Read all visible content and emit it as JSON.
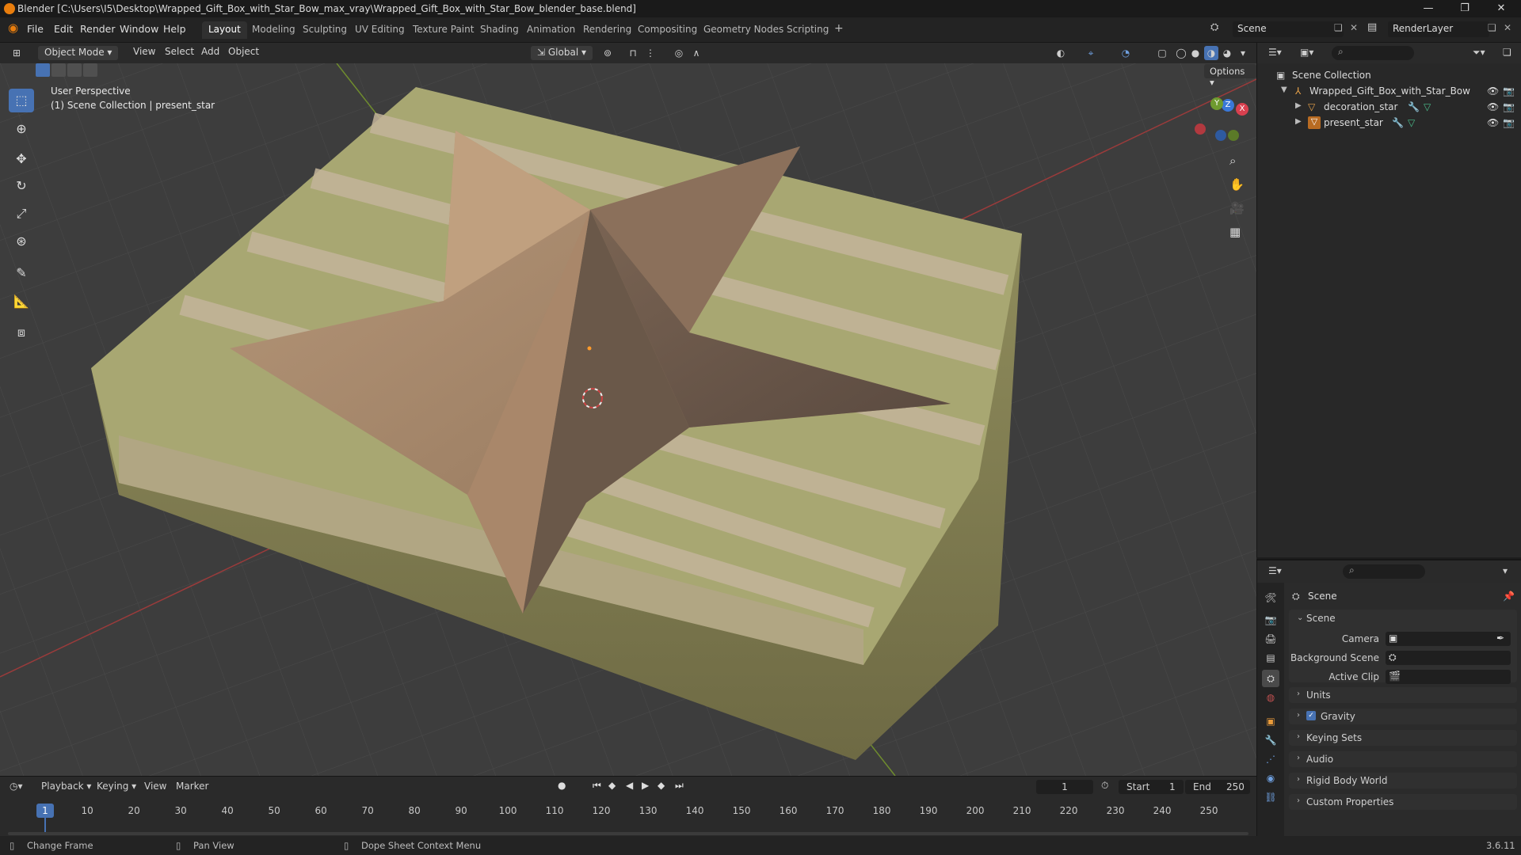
{
  "window": {
    "title": "Blender [C:\\Users\\I5\\Desktop\\Wrapped_Gift_Box_with_Star_Bow_max_vray\\Wrapped_Gift_Box_with_Star_Bow_blender_base.blend]",
    "minimize": "—",
    "maximize": "❐",
    "close": "✕"
  },
  "menu": {
    "items": [
      "File",
      "Edit",
      "Render",
      "Window",
      "Help"
    ],
    "workspaces": [
      "Layout",
      "Modeling",
      "Sculpting",
      "UV Editing",
      "Texture Paint",
      "Shading",
      "Animation",
      "Rendering",
      "Compositing",
      "Geometry Nodes",
      "Scripting"
    ],
    "active_workspace": "Layout",
    "add_tab": "+",
    "scene": "Scene",
    "view_layer": "RenderLayer"
  },
  "viewport_header": {
    "mode": "Object Mode",
    "menus": [
      "View",
      "Select",
      "Add",
      "Object"
    ],
    "orientation": "Global",
    "options": "Options"
  },
  "viewport": {
    "perspective": "User Perspective",
    "collection_info": "(1) Scene Collection | present_star",
    "gizmo_x": "X",
    "gizmo_y": "Y",
    "gizmo_z": "Z"
  },
  "outliner": {
    "root": "Scene Collection",
    "collection": "Wrapped_Gift_Box_with_Star_Bow",
    "objects": [
      "decoration_star",
      "present_star"
    ]
  },
  "properties": {
    "context": "Scene",
    "panel_title": "Scene",
    "camera_label": "Camera",
    "background_label": "Background Scene",
    "clip_label": "Active Clip",
    "sections": [
      "Units",
      "Gravity",
      "Keying Sets",
      "Audio",
      "Rigid Body World",
      "Custom Properties"
    ]
  },
  "timeline": {
    "menus": [
      "Playback",
      "Keying",
      "View",
      "Marker"
    ],
    "current_frame": "1",
    "start_label": "Start",
    "start": "1",
    "end_label": "End",
    "end": "250",
    "ticks": [
      "1",
      "10",
      "20",
      "30",
      "40",
      "50",
      "60",
      "70",
      "80",
      "90",
      "100",
      "110",
      "120",
      "130",
      "140",
      "150",
      "160",
      "170",
      "180",
      "190",
      "200",
      "210",
      "220",
      "230",
      "240",
      "250"
    ]
  },
  "statusbar": {
    "hint1": "Change Frame",
    "hint2": "Pan View",
    "hint3": "Dope Sheet Context Menu",
    "version": "3.6.11"
  },
  "colors": {
    "accent": "#4772b3",
    "active_frame": "#4772b3",
    "gift_wrap": "#a8a772",
    "star": "#a68a6e",
    "axis_x": "#c0392b",
    "axis_y": "#7fa030"
  }
}
